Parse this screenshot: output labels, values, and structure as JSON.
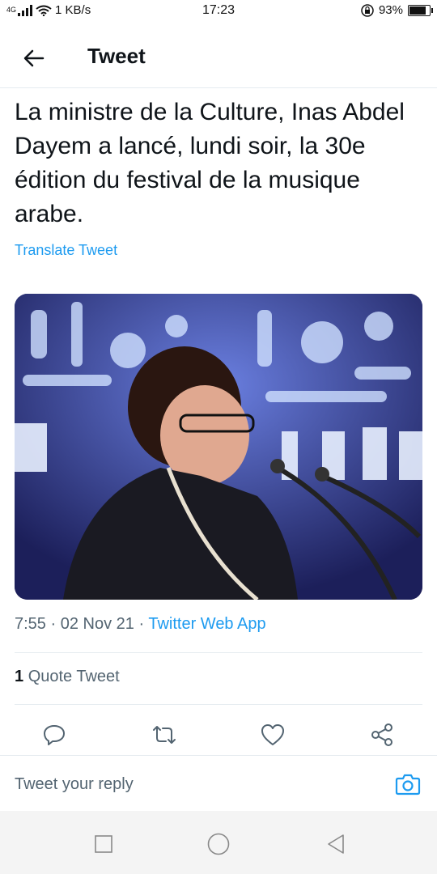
{
  "status_bar": {
    "network_type": "4G",
    "speed": "1 KB/s",
    "time": "17:23",
    "battery": "93%",
    "battery_level": 0.93
  },
  "header": {
    "title": "Tweet",
    "back_icon": "arrow-left-icon"
  },
  "tweet": {
    "text": "La ministre de la Culture, Inas Abdel Dayem a lancé, lundi soir, la 30e édition du festival de la musique arabe.",
    "translate_label": "Translate Tweet",
    "time": "7:55",
    "date": "02 Nov 21",
    "separator": "·",
    "app": "Twitter Web App",
    "quote_count": "1",
    "quote_label": "Quote Tweet"
  },
  "actions": [
    {
      "name": "reply",
      "icon": "reply-icon"
    },
    {
      "name": "retweet",
      "icon": "retweet-icon"
    },
    {
      "name": "like",
      "icon": "heart-icon"
    },
    {
      "name": "share",
      "icon": "share-icon"
    }
  ],
  "reply_bar": {
    "placeholder": "Tweet your reply",
    "camera_icon": "camera-icon"
  },
  "nav_bar": {
    "buttons": [
      "recent-apps-icon",
      "home-icon",
      "back-icon"
    ]
  },
  "colors": {
    "accent": "#1d9bf0",
    "text": "#0f1419",
    "secondary": "#536471",
    "divider": "#e6ecf0"
  }
}
